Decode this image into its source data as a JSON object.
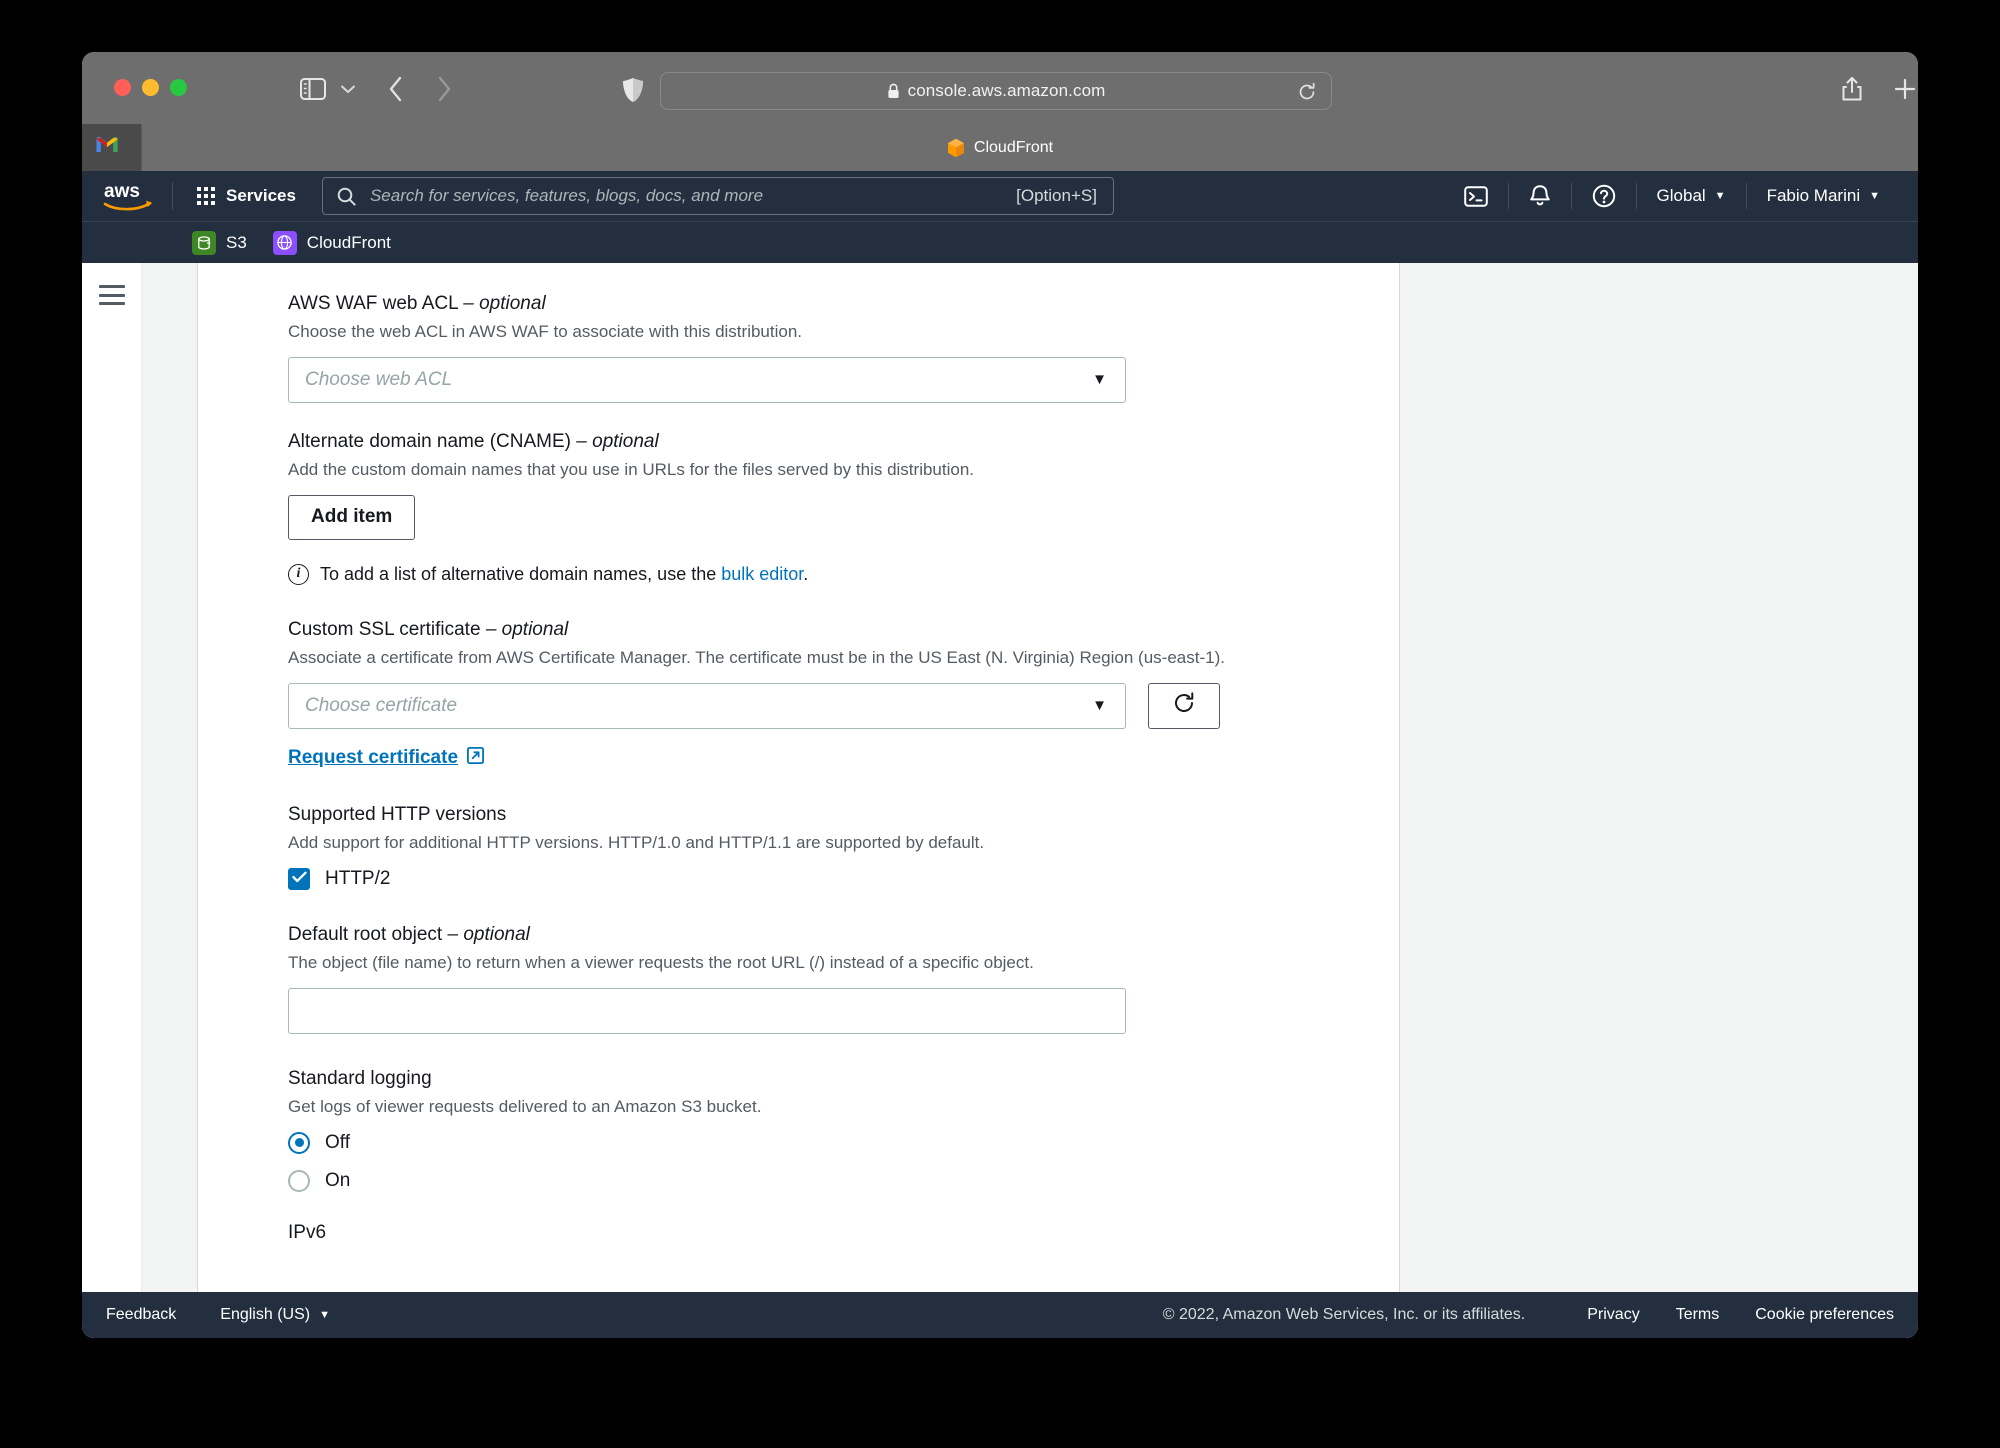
{
  "browser": {
    "address": "console.aws.amazon.com",
    "lock_icon": "lock-icon",
    "reload_icon": "reload-icon",
    "back_icon": "chevron-left-icon",
    "forward_icon": "chevron-right-icon",
    "sidebar_icon": "sidebar-toggle-icon",
    "sidebar_caret": "chevron-down-icon",
    "shield_icon": "shield-icon",
    "share_icon": "share-icon",
    "newtab_icon": "plus-icon",
    "tabs_overview_icon": "tab-grid-icon",
    "tabs": [
      {
        "label": "",
        "icon": "gmail-icon",
        "glyph": "M",
        "active": false
      },
      {
        "label": "CloudFront",
        "icon": "cloudfront-cube-icon",
        "active": true
      }
    ]
  },
  "topnav": {
    "logo": "aws-logo",
    "services_label": "Services",
    "services_icon": "grid-menu-icon",
    "search": {
      "icon": "search-icon",
      "placeholder": "Search for services, features, blogs, docs, and more",
      "shortcut": "[Option+S]"
    },
    "cloudshell_icon": "cloudshell-terminal-icon",
    "notifications_icon": "bell-icon",
    "help_icon": "question-circle-icon",
    "region_label": "Global",
    "account_label": "Fabio Marini",
    "caret": "▼"
  },
  "servicebar": {
    "items": [
      {
        "label": "S3",
        "icon": "s3-bucket-icon"
      },
      {
        "label": "CloudFront",
        "icon": "cloudfront-icon"
      }
    ]
  },
  "sidebar": {
    "hamburger_icon": "hamburger-menu-icon"
  },
  "form": {
    "waf": {
      "label": "AWS WAF web ACL",
      "optional": "– optional",
      "desc": "Choose the web ACL in AWS WAF to associate with this distribution.",
      "placeholder": "Choose web ACL",
      "caret_icon": "chevron-down-icon"
    },
    "cname": {
      "label": "Alternate domain name (CNAME)",
      "optional": "– optional",
      "desc": "Add the custom domain names that you use in URLs for the files served by this distribution.",
      "add_item_label": "Add item",
      "info_icon": "info-circle-icon",
      "info_prefix": "To add a list of alternative domain names, use the ",
      "info_link": "bulk editor",
      "info_suffix": "."
    },
    "ssl": {
      "label": "Custom SSL certificate",
      "optional": "– optional",
      "desc": "Associate a certificate from AWS Certificate Manager. The certificate must be in the US East (N. Virginia) Region (us-east-1).",
      "placeholder": "Choose certificate",
      "caret_icon": "chevron-down-icon",
      "refresh_icon": "refresh-icon",
      "request_link": "Request certificate",
      "external_icon": "external-link-icon"
    },
    "http": {
      "label": "Supported HTTP versions",
      "desc": "Add support for additional HTTP versions. HTTP/1.0 and HTTP/1.1 are supported by default.",
      "checkbox_label": "HTTP/2",
      "checkbox_checked": true,
      "check_icon": "checkmark-icon"
    },
    "root_object": {
      "label": "Default root object",
      "optional": "– optional",
      "desc": "The object (file name) to return when a viewer requests the root URL (/) instead of a specific object.",
      "value": ""
    },
    "logging": {
      "label": "Standard logging",
      "desc": "Get logs of viewer requests delivered to an Amazon S3 bucket.",
      "options": [
        {
          "label": "Off",
          "selected": true
        },
        {
          "label": "On",
          "selected": false
        }
      ]
    },
    "ipv6": {
      "label": "IPv6"
    }
  },
  "footer": {
    "feedback": "Feedback",
    "language": "English (US)",
    "language_caret": "▼",
    "copyright": "© 2022, Amazon Web Services, Inc. or its affiliates.",
    "privacy": "Privacy",
    "terms": "Terms",
    "cookie_preferences": "Cookie preferences"
  },
  "colors": {
    "aws_navy": "#232f3e",
    "aws_orange": "#ff9900",
    "link_blue": "#0073bb",
    "page_bg": "#f2f3f3",
    "s3_green": "#3f8624",
    "cloudfront_purple": "#8c4fff"
  }
}
